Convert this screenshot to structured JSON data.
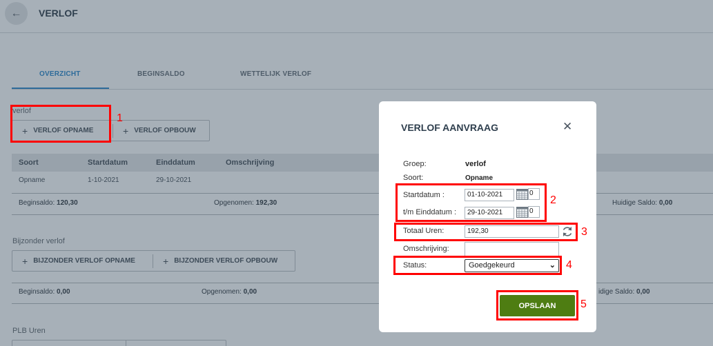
{
  "header": {
    "back_icon": "arrow-left-icon",
    "title": "VERLOF"
  },
  "tabs": [
    {
      "label": "OVERZICHT",
      "active": true
    },
    {
      "label": "BEGINSALDO",
      "active": false
    },
    {
      "label": "WETTELIJK VERLOF",
      "active": false
    }
  ],
  "verlof": {
    "label": "verlof",
    "buttons": [
      "VERLOF OPNAME",
      "VERLOF OPBOUW"
    ],
    "columns": [
      "Soort",
      "Startdatum",
      "Einddatum",
      "Omschrijving"
    ],
    "rows": [
      {
        "soort": "Opname",
        "start": "1-10-2021",
        "eind": "29-10-2021",
        "omschrijving": ""
      }
    ],
    "beginsaldo_label": "Beginsaldo:",
    "beginsaldo_value": "120,30",
    "opgenomen_label": "Opgenomen:",
    "opgenomen_value": "192,30",
    "huidige_label": "Huidige Saldo:",
    "huidige_value": "0,00"
  },
  "bijzonder": {
    "label": "Bijzonder verlof",
    "buttons": [
      "BIJZONDER VERLOF OPNAME",
      "BIJZONDER VERLOF OPBOUW"
    ],
    "beginsaldo_label": "Beginsaldo:",
    "beginsaldo_value": "0,00",
    "opgenomen_label": "Opgenomen:",
    "opgenomen_value": "0,00",
    "huidige_label": "idige Saldo:",
    "huidige_value": "0,00"
  },
  "plb": {
    "label": "PLB Uren"
  },
  "modal": {
    "title": "VERLOF AANVRAAG",
    "close_icon": "close-icon",
    "groep_label": "Groep:",
    "groep_value": "verlof",
    "soort_label": "Soort:",
    "soort_value": "Opname",
    "startdatum_label": "Startdatum :",
    "startdatum_value": "01-10-2021",
    "startdatum_extra": "0",
    "einddatum_label": "t/m Einddatum :",
    "einddatum_value": "29-10-2021",
    "einddatum_extra": "0",
    "totaal_label": "Totaal Uren:",
    "totaal_value": "192,30",
    "omschrijving_label": "Omschrijving:",
    "omschrijving_value": "",
    "status_label": "Status:",
    "status_value": "Goedgekeurd",
    "save_label": "OPSLAAN"
  },
  "annotations": [
    "1",
    "2",
    "3",
    "4",
    "5"
  ],
  "colors": {
    "annotation": "#ff0000",
    "save_button": "#4e7d12",
    "active_tab": "#2d6b9a"
  }
}
